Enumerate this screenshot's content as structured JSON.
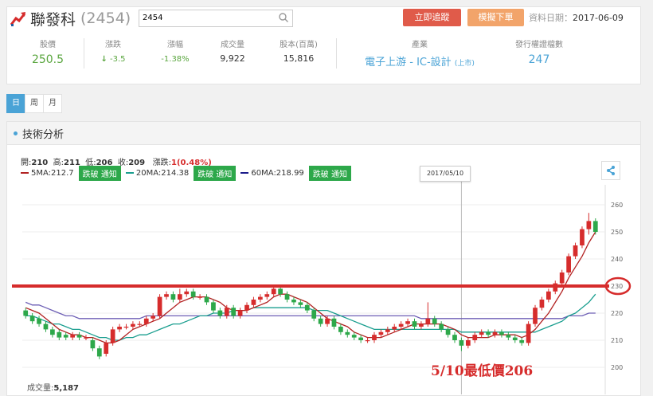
{
  "header": {
    "name": "聯發科",
    "code": "(2454)",
    "search_value": "2454",
    "track_label": "立即追蹤",
    "order_label": "模擬下單",
    "date_label": "資料日期：",
    "date_value": "2017-06-09"
  },
  "stats": [
    {
      "label": "股價",
      "value": "250.5",
      "color": "#5aa63f"
    },
    {
      "label": "漲跌",
      "value": "-3.5",
      "color": "#5aa63f"
    },
    {
      "label": "漲幅",
      "value": "-1.38%",
      "color": "#5aa63f"
    },
    {
      "label": "成交量",
      "value": "9,922",
      "color": "#333333"
    },
    {
      "label": "股本(百萬)",
      "value": "15,816",
      "color": "#333333"
    },
    {
      "label": "產業",
      "value": "電子上游 - IC-設計",
      "suffix": "(上市)",
      "color": "#4aa3d6"
    },
    {
      "label": "發行權證檔數",
      "value": "247",
      "color": "#4aa3d6"
    }
  ],
  "periods": [
    "日",
    "周",
    "月"
  ],
  "panel_title": "技術分析",
  "ohlc": {
    "open_label": "開:",
    "open": "210",
    "high_label": "高:",
    "high": "211",
    "low_label": "低:",
    "low": "206",
    "close_label": "收:",
    "close": "209",
    "change_label": "漲跌:",
    "change": "1(0.48%)"
  },
  "ma": [
    {
      "label": "5MA:212.7",
      "color": "#b22222",
      "notify": "跌破 通知"
    },
    {
      "label": "20MA:214.38",
      "color": "#1a9e8f",
      "notify": "跌破 通知"
    },
    {
      "label": "60MA:218.99",
      "color": "#1b1b8a",
      "notify": "跌破 通知"
    }
  ],
  "cursor_date": "2017/05/10",
  "volume_label": "成交量:",
  "volume_value": "5,187",
  "annotation": "5/10最低價206",
  "colors": {
    "up": "#d62c2c",
    "down": "#2da84a",
    "ma5": "#b22222",
    "ma20": "#1a9e8f",
    "ma60": "#6d5fb5",
    "accent": "#4aa3d6",
    "resistance": "#d62c2c"
  },
  "chart_data": {
    "type": "candlestick",
    "y_ticks": [
      200,
      210,
      220,
      230,
      240,
      250,
      260
    ],
    "ylim": [
      198,
      266
    ],
    "resistance_level": 230,
    "candles": [
      [
        221,
        219,
        222,
        218
      ],
      [
        219,
        217,
        220,
        216
      ],
      [
        218,
        216,
        219,
        215
      ],
      [
        216,
        214,
        217,
        213
      ],
      [
        214,
        212,
        215,
        211
      ],
      [
        213,
        211,
        214,
        210
      ],
      [
        212,
        211,
        213,
        210
      ],
      [
        211,
        212,
        213,
        210
      ],
      [
        212,
        211,
        213,
        210
      ],
      [
        211,
        211,
        212,
        210
      ],
      [
        210,
        207,
        211,
        206
      ],
      [
        207,
        204,
        208,
        203
      ],
      [
        205,
        209,
        210,
        204
      ],
      [
        209,
        214,
        215,
        208
      ],
      [
        214,
        215,
        216,
        213
      ],
      [
        215,
        215,
        216,
        214
      ],
      [
        215,
        216,
        217,
        214
      ],
      [
        216,
        216,
        217,
        215
      ],
      [
        216,
        218,
        219,
        215
      ],
      [
        218,
        219,
        220,
        217
      ],
      [
        219,
        226,
        227,
        218
      ],
      [
        226,
        227,
        228,
        225
      ],
      [
        227,
        225,
        228,
        224
      ],
      [
        225,
        227,
        229,
        224
      ],
      [
        227,
        228,
        229,
        226
      ],
      [
        228,
        226,
        229,
        225
      ],
      [
        226,
        226,
        227,
        225
      ],
      [
        226,
        224,
        227,
        223
      ],
      [
        224,
        221,
        225,
        220
      ],
      [
        221,
        219,
        222,
        218
      ],
      [
        219,
        222,
        223,
        218
      ],
      [
        222,
        219,
        223,
        218
      ],
      [
        219,
        221,
        222,
        218
      ],
      [
        221,
        223,
        224,
        220
      ],
      [
        223,
        225,
        226,
        222
      ],
      [
        225,
        226,
        227,
        224
      ],
      [
        226,
        227,
        228,
        225
      ],
      [
        227,
        229,
        230,
        226
      ],
      [
        229,
        227,
        230,
        226
      ],
      [
        227,
        225,
        228,
        224
      ],
      [
        225,
        224,
        226,
        223
      ],
      [
        224,
        223,
        225,
        222
      ],
      [
        223,
        221,
        224,
        220
      ],
      [
        221,
        218,
        222,
        217
      ],
      [
        218,
        216,
        219,
        215
      ],
      [
        216,
        218,
        219,
        215
      ],
      [
        218,
        215,
        219,
        214
      ],
      [
        215,
        213,
        216,
        212
      ],
      [
        213,
        212,
        214,
        211
      ],
      [
        212,
        211,
        213,
        210
      ],
      [
        211,
        210,
        212,
        209
      ],
      [
        210,
        210,
        211,
        209
      ],
      [
        210,
        212,
        213,
        209
      ],
      [
        212,
        213,
        214,
        211
      ],
      [
        213,
        214,
        215,
        212
      ],
      [
        214,
        215,
        216,
        213
      ],
      [
        215,
        216,
        217,
        214
      ],
      [
        216,
        217,
        218,
        215
      ],
      [
        217,
        215,
        218,
        214
      ],
      [
        215,
        216,
        217,
        214
      ],
      [
        216,
        218,
        224,
        215
      ],
      [
        218,
        216,
        219,
        215
      ],
      [
        216,
        214,
        217,
        213
      ],
      [
        214,
        212,
        215,
        211
      ],
      [
        212,
        210,
        213,
        209
      ],
      [
        210,
        208,
        211,
        206
      ],
      [
        208,
        210,
        211,
        207
      ],
      [
        210,
        212,
        213,
        209
      ],
      [
        212,
        213,
        214,
        211
      ],
      [
        213,
        212,
        214,
        211
      ],
      [
        212,
        213,
        214,
        211
      ],
      [
        213,
        212,
        214,
        211
      ],
      [
        212,
        211,
        213,
        210
      ],
      [
        211,
        210,
        212,
        209
      ],
      [
        210,
        209,
        211,
        208
      ],
      [
        209,
        216,
        217,
        208
      ],
      [
        216,
        222,
        223,
        215
      ],
      [
        222,
        225,
        226,
        221
      ],
      [
        225,
        228,
        229,
        224
      ],
      [
        228,
        231,
        232,
        227
      ],
      [
        231,
        235,
        236,
        230
      ],
      [
        235,
        241,
        242,
        234
      ],
      [
        241,
        245,
        246,
        240
      ],
      [
        245,
        251,
        252,
        244
      ],
      [
        251,
        254,
        257,
        249
      ],
      [
        254,
        250,
        255,
        249
      ]
    ],
    "ma5": [
      222,
      221,
      220,
      218,
      216,
      214,
      213,
      212,
      212,
      211,
      211,
      210,
      209,
      209,
      210,
      212,
      214,
      215,
      216,
      217,
      218,
      220,
      222,
      224,
      225,
      226,
      226,
      226,
      225,
      224,
      222,
      221,
      221,
      221,
      222,
      223,
      224,
      226,
      227,
      227,
      226,
      225,
      224,
      222,
      220,
      218,
      217,
      216,
      215,
      213,
      212,
      211,
      211,
      211,
      212,
      213,
      214,
      215,
      216,
      216,
      216,
      216,
      216,
      215,
      214,
      212,
      211,
      211,
      211,
      211,
      212,
      212,
      212,
      212,
      211,
      212,
      214,
      217,
      220,
      224,
      228,
      233,
      237,
      241,
      246,
      250
    ],
    "ma20": [
      219,
      219,
      218,
      217,
      216,
      216,
      215,
      214,
      214,
      213,
      212,
      211,
      211,
      210,
      210,
      211,
      211,
      212,
      212,
      213,
      214,
      215,
      216,
      216,
      217,
      218,
      219,
      219,
      220,
      220,
      220,
      221,
      221,
      221,
      222,
      222,
      222,
      222,
      222,
      222,
      222,
      222,
      222,
      221,
      221,
      221,
      220,
      219,
      218,
      217,
      216,
      215,
      214,
      214,
      214,
      214,
      214,
      214,
      214,
      214,
      214,
      214,
      214,
      214,
      214,
      213,
      213,
      213,
      213,
      213,
      213,
      213,
      213,
      213,
      213,
      213,
      213,
      214,
      215,
      216,
      217,
      219,
      220,
      222,
      224,
      227
    ],
    "ma60": [
      224,
      223,
      223,
      222,
      221,
      220,
      219,
      219,
      218,
      218,
      218,
      218,
      218,
      218,
      218,
      218,
      218,
      218,
      219,
      219,
      219,
      219,
      219,
      219,
      219,
      219,
      219,
      219,
      219,
      219,
      219,
      219,
      219,
      219,
      219,
      219,
      219,
      219,
      219,
      219,
      219,
      219,
      219,
      219,
      219,
      219,
      219,
      219,
      219,
      219,
      219,
      219,
      219,
      219,
      219,
      219,
      219,
      219,
      219,
      218,
      218,
      218,
      218,
      218,
      218,
      218,
      218,
      218,
      218,
      218,
      218,
      218,
      218,
      218,
      218,
      218,
      218,
      218,
      218,
      218,
      218,
      219,
      219,
      219,
      220,
      220
    ]
  }
}
